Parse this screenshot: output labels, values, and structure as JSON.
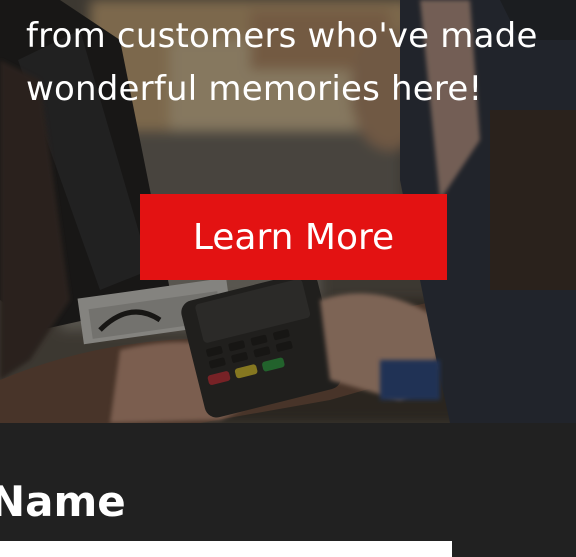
{
  "hero": {
    "line_1": "from customers who've made",
    "line_2": "wonderful memories here!",
    "cta_label": "Learn More"
  },
  "form": {
    "name_label": "Name",
    "name_value": ""
  },
  "colors": {
    "accent": "#e31212",
    "section_background": "#212121",
    "text": "#ffffff"
  }
}
